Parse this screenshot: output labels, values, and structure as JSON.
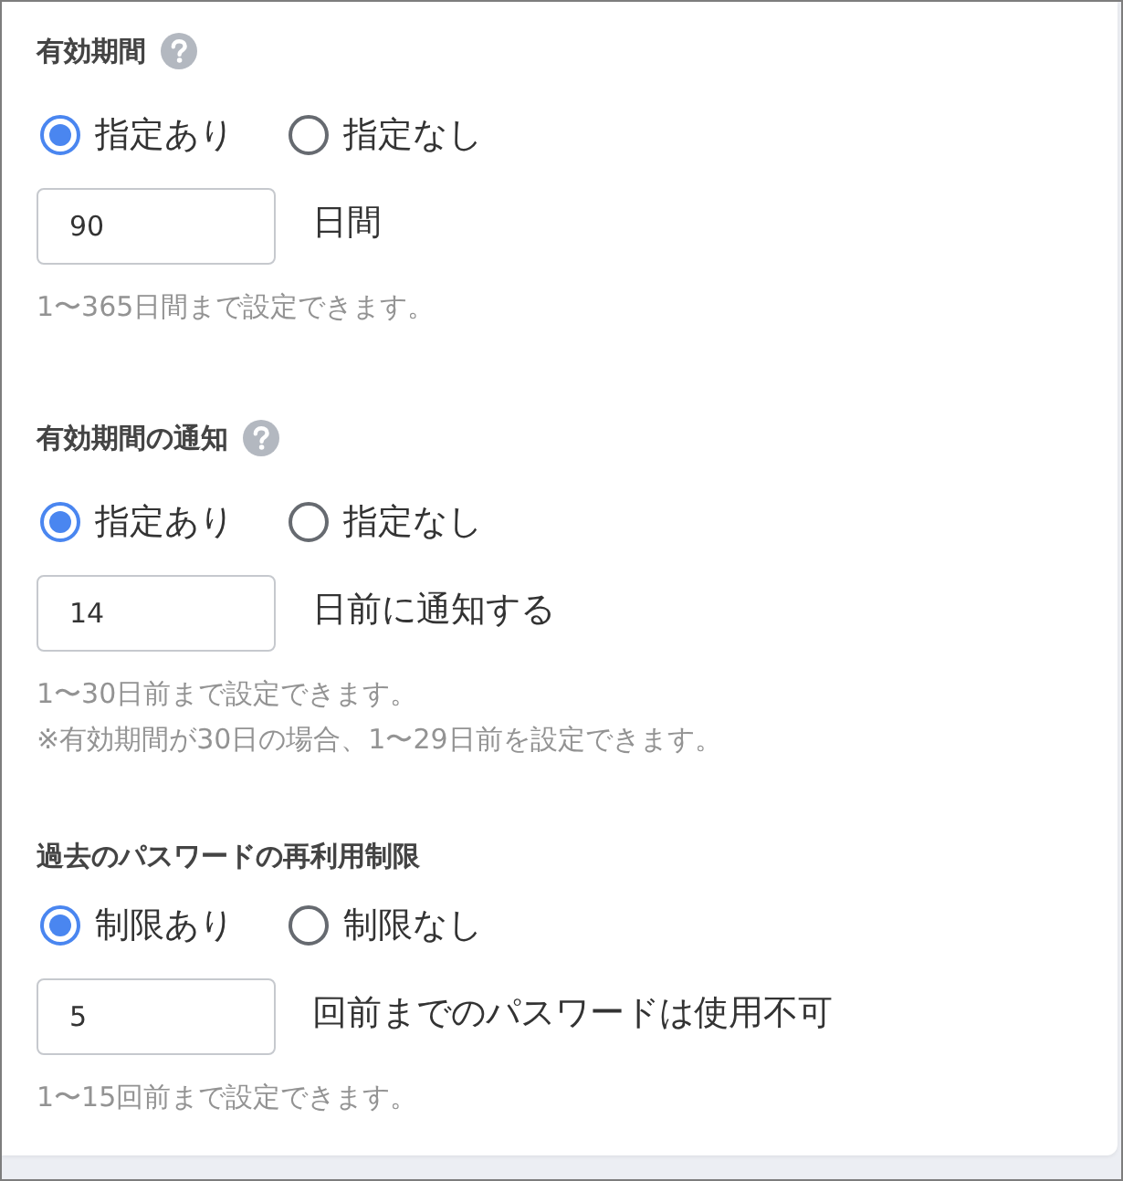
{
  "sections": [
    {
      "title": "有効期間",
      "help_icon": true,
      "options": [
        {
          "label": "指定あり",
          "selected": true
        },
        {
          "label": "指定なし",
          "selected": false
        }
      ],
      "input": {
        "value": "90"
      },
      "suffix": "日間",
      "hints": [
        "1〜365日間まで設定できます。"
      ]
    },
    {
      "title": "有効期間の通知",
      "help_icon": true,
      "options": [
        {
          "label": "指定あり",
          "selected": true
        },
        {
          "label": "指定なし",
          "selected": false
        }
      ],
      "input": {
        "value": "14"
      },
      "suffix": "日前に通知する",
      "hints": [
        "1〜30日前まで設定できます。",
        "※有効期間が30日の場合、1〜29日前を設定できます。"
      ]
    },
    {
      "title": "過去のパスワードの再利用制限",
      "help_icon": false,
      "options": [
        {
          "label": "制限あり",
          "selected": true
        },
        {
          "label": "制限なし",
          "selected": false
        }
      ],
      "input": {
        "value": "5"
      },
      "suffix": "回前までのパスワードは使用不可",
      "hints": [
        "1〜15回前まで設定できます。"
      ]
    }
  ]
}
